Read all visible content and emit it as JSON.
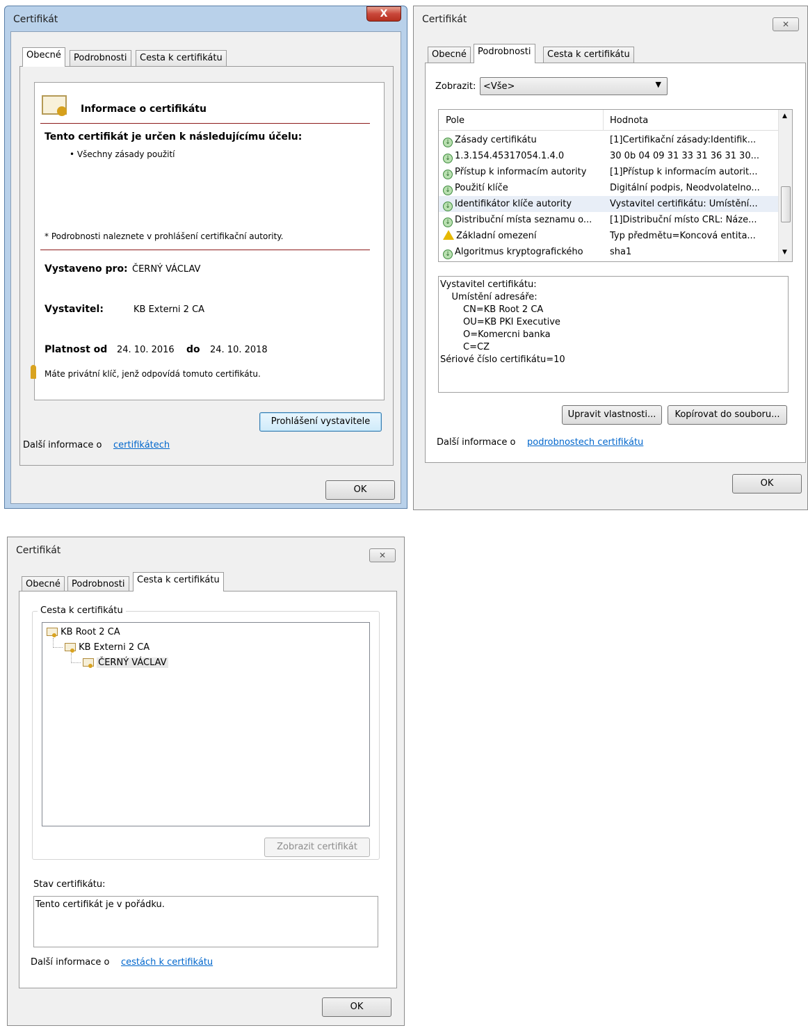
{
  "dialog1": {
    "title": "Certifikát",
    "close_glyph": "X",
    "tabs": [
      "Obecné",
      "Podrobnosti",
      "Cesta k certifikátu"
    ],
    "info_title": "Informace o certifikátu",
    "purpose_heading": "Tento certifikát je určen k následujícímu účelu:",
    "purpose_item": "• Všechny zásady použití",
    "details_note": "* Podrobnosti naleznete v prohlášení certifikační autority.",
    "issued_to_label": "Vystaveno pro:",
    "issued_to_value": "ČERNÝ VÁCLAV",
    "issuer_label": "Vystavitel:",
    "issuer_value": "KB Externi 2 CA",
    "valid_from_label": "Platnost od",
    "valid_from_value": "24. 10. 2016",
    "valid_to_label": "do",
    "valid_to_value": "24. 10. 2018",
    "private_key_note": "Máte privátní klíč, jenž odpovídá tomuto certifikátu.",
    "issuer_statement_button": "Prohlášení vystavitele",
    "more_info_prefix": "Další informace o",
    "more_info_link": "certifikátech",
    "ok_button": "OK"
  },
  "dialog2": {
    "title": "Certifikát",
    "close_glyph": "✕",
    "tabs": [
      "Obecné",
      "Podrobnosti",
      "Cesta k certifikátu"
    ],
    "show_label": "Zobrazit:",
    "show_value": "<Vše>",
    "columns": [
      "Pole",
      "Hodnota"
    ],
    "rows": [
      {
        "field": "Zásady certifikátu",
        "value": "[1]Certifikační zásady:Identifik...",
        "icon": "info-icon"
      },
      {
        "field": "1.3.154.45317054.1.4.0",
        "value": "30 0b 04 09 31 33 31 36 31 30...",
        "icon": "info-icon"
      },
      {
        "field": "Přístup k informacím autority",
        "value": "[1]Přístup k informacím autorit...",
        "icon": "info-icon"
      },
      {
        "field": "Použití klíče",
        "value": "Digitální podpis, Neodvolatelno...",
        "icon": "info-icon"
      },
      {
        "field": "Identifikátor klíče autority",
        "value": "Vystavitel certifikátu: Umístění...",
        "icon": "info-icon"
      },
      {
        "field": "Distribuční místa seznamu o...",
        "value": "[1]Distribuční místo CRL: Náze...",
        "icon": "info-icon"
      },
      {
        "field": "Základní omezení",
        "value": "Typ předmětu=Koncová entita...",
        "icon": "warning-icon"
      },
      {
        "field": "Algoritmus kryptografického",
        "value": "sha1",
        "icon": "info-icon"
      }
    ],
    "detail_lines": [
      "Vystavitel certifikátu:",
      "    Umístění adresáře:",
      "        CN=KB Root 2 CA",
      "        OU=KB PKI Executive",
      "        O=Komercni banka",
      "        C=CZ",
      "Sériové číslo certifikátu=10"
    ],
    "edit_button": "Upravit vlastnosti...",
    "copy_button": "Kopírovat do souboru...",
    "more_info_prefix": "Další informace o",
    "more_info_link": "podrobnostech certifikátu",
    "ok_button": "OK"
  },
  "dialog3": {
    "title": "Certifikát",
    "close_glyph": "✕",
    "tabs": [
      "Obecné",
      "Podrobnosti",
      "Cesta k certifikátu"
    ],
    "group_label": "Cesta k certifikátu",
    "tree": [
      "KB Root 2 CA",
      "KB Externi 2 CA",
      "ČERNÝ VÁCLAV"
    ],
    "view_button": "Zobrazit certifikát",
    "status_label": "Stav certifikátu:",
    "status_value": "Tento certifikát je v pořádku.",
    "more_info_prefix": "Další informace o",
    "more_info_link": "cestách k certifikátu",
    "ok_button": "OK"
  }
}
